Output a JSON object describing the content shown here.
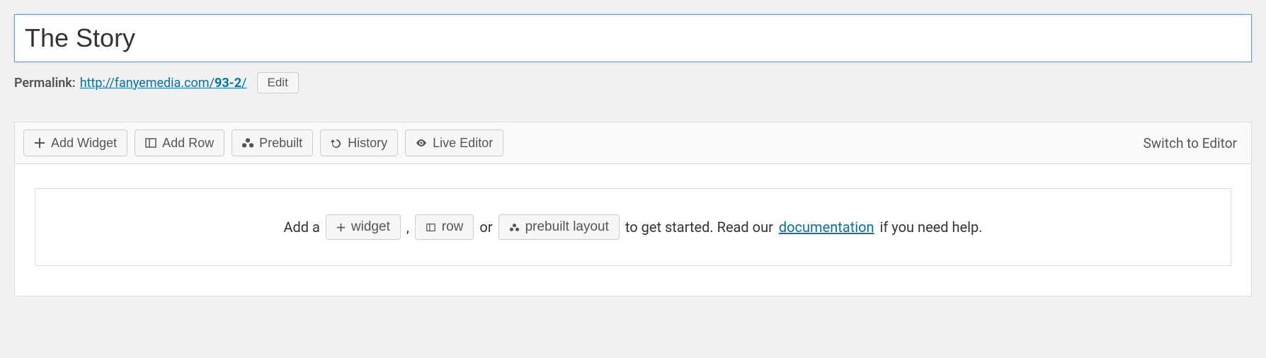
{
  "title": "The Story",
  "permalink": {
    "label": "Permalink:",
    "base": "http://fanyemedia.com/",
    "slug": "93-2",
    "trail": "/",
    "edit_label": "Edit"
  },
  "toolbar": {
    "add_widget": "Add Widget",
    "add_row": "Add Row",
    "prebuilt": "Prebuilt",
    "history": "History",
    "live_editor": "Live Editor",
    "switch_editor": "Switch to Editor"
  },
  "empty_state": {
    "prefix": "Add a",
    "widget_btn": "widget",
    "comma": ",",
    "row_btn": "row",
    "or": "or",
    "prebuilt_btn": "prebuilt layout",
    "middle": "to get started. Read our",
    "doc_link": "documentation",
    "suffix": "if you need help."
  }
}
